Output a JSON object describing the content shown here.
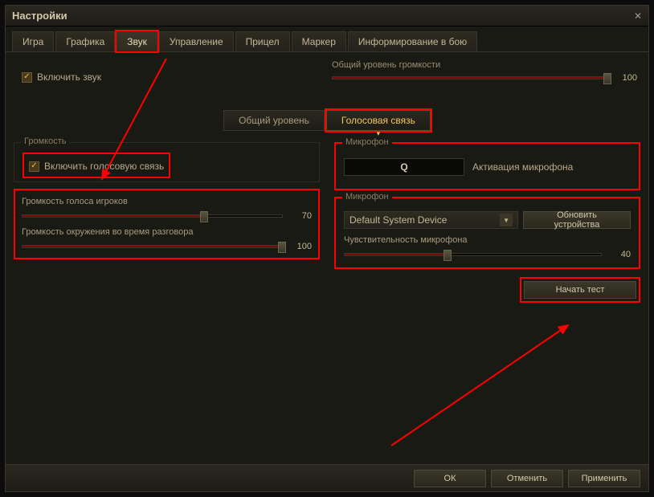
{
  "window": {
    "title": "Настройки"
  },
  "tabs": [
    "Игра",
    "Графика",
    "Звук",
    "Управление",
    "Прицел",
    "Маркер",
    "Информирование в бою"
  ],
  "active_tab": 2,
  "enable_sound": {
    "label": "Включить звук",
    "checked": true
  },
  "master_volume": {
    "label": "Общий уровень громкости",
    "value": 100
  },
  "subtabs": [
    "Общий уровень",
    "Голосовая связь"
  ],
  "active_subtab": 1,
  "left": {
    "group_title": "Громкость",
    "enable_voice": {
      "label": "Включить голосовую связь",
      "checked": true
    },
    "voice_volume": {
      "label": "Громкость голоса игроков",
      "value": 70
    },
    "ambient_volume": {
      "label": "Громкость окружения во время разговора",
      "value": 100
    }
  },
  "right": {
    "mic_group": "Микрофон",
    "key": "Q",
    "key_label": "Активация микрофона",
    "device_group": "Микрофон",
    "device_selected": "Default System Device",
    "refresh_btn": "Обновить устройства",
    "sensitivity": {
      "label": "Чувствительность микрофона",
      "value": 40
    },
    "test_btn": "Начать тест"
  },
  "footer": {
    "ok": "ОК",
    "cancel": "Отменить",
    "apply": "Применить"
  }
}
